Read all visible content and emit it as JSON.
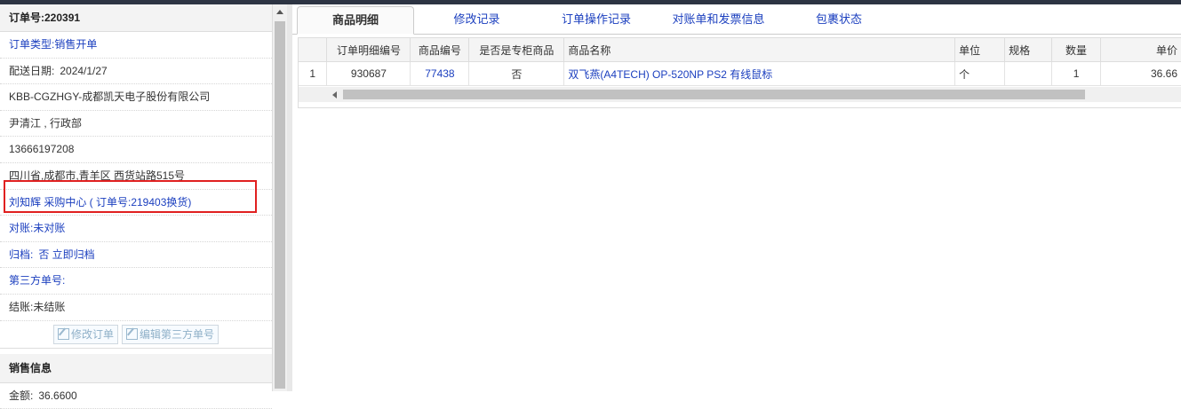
{
  "order": {
    "number_label": "订单号:",
    "number_value": "220391",
    "type_label": "订单类型:",
    "type_value": "销售开单",
    "delivery_label": "配送日期:",
    "delivery_value": "2024/1/27",
    "company": "KBB-CGZHGY-成都凯天电子股份有限公司",
    "contact": "尹清江 , 行政部",
    "phone": "13666197208",
    "address": "四川省,成都市,青羊区 西货站路515号",
    "purchaser": "刘知辉 采购中心 ( 订单号:219403换货)",
    "reconcile_label": "对账:",
    "reconcile_value": "未对账",
    "archive_label": "归档:",
    "archive_value": "否 立即归档",
    "third_party_label": "第三方单号:",
    "settle_label": "结账:",
    "settle_value": "未结账",
    "edit_order_button": "修改订单",
    "edit_third_party_button": "编辑第三方单号"
  },
  "sales": {
    "section_title": "销售信息",
    "amount_label": "金额:",
    "amount_value": "36.6600"
  },
  "tabs": [
    {
      "label": "商品明细",
      "active": true
    },
    {
      "label": "修改记录"
    },
    {
      "label": "订单操作记录"
    },
    {
      "label": "对账单和发票信息"
    },
    {
      "label": "包裹状态"
    }
  ],
  "table": {
    "headers": [
      "",
      "订单明细编号",
      "商品编号",
      "是否是专柜商品",
      "商品名称",
      "单位",
      "规格",
      "数量",
      "单价"
    ],
    "rows": [
      [
        "1",
        "930687",
        "77438",
        "否",
        "双飞燕(A4TECH) OP-520NP PS2 有线鼠标",
        "个",
        "",
        "1",
        "36.66"
      ]
    ]
  },
  "colors": {
    "link": "#1b3fbf",
    "highlight_box": "#e02020",
    "top_strip": "#2d3443"
  }
}
